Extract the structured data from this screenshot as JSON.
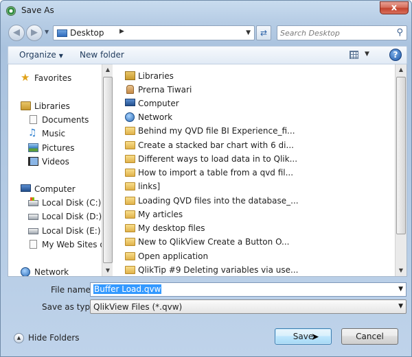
{
  "window": {
    "title": "Save As",
    "close_label": "x"
  },
  "address": {
    "location": "Desktop"
  },
  "search": {
    "placeholder": "Search Desktop"
  },
  "toolbar": {
    "organize_label": "Organize",
    "new_folder_label": "New folder",
    "help_label": "?"
  },
  "nav": {
    "favorites": "Favorites",
    "libraries": "Libraries",
    "library_items": [
      "Documents",
      "Music",
      "Pictures",
      "Videos"
    ],
    "computer": "Computer",
    "computer_items": [
      "Local Disk (C:)",
      "Local Disk (D:)",
      "Local Disk (E:)",
      "My Web Sites on"
    ],
    "network": "Network"
  },
  "files": [
    "Libraries",
    "Prerna Tiwari",
    "Computer",
    "Network",
    "Behind my QVD file  BI Experience_fi...",
    "Create a stacked bar chart with 6 di...",
    "Different ways to load data in to Qlik...",
    "How to import a table from a qvd fil...",
    "links]",
    "Loading QVD files into the database_...",
    "My articles",
    "My desktop files",
    "New to QlikView  Create a Button O...",
    "Open application",
    "QlikTip #9  Deleting variables via use..."
  ],
  "form": {
    "file_name_label": "File name:",
    "file_name_value": "Buffer Load.qvw",
    "save_type_label": "Save as type:",
    "save_type_value": "QlikView Files (*.qvw)"
  },
  "footer": {
    "hide_folders_label": "Hide Folders",
    "save_label": "Save",
    "cancel_label": "Cancel"
  }
}
